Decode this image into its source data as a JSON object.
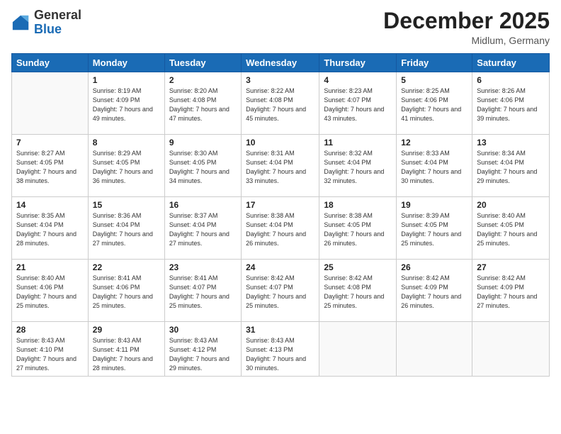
{
  "header": {
    "logo": {
      "general": "General",
      "blue": "Blue"
    },
    "title": "December 2025",
    "location": "Midlum, Germany"
  },
  "calendar": {
    "weekdays": [
      "Sunday",
      "Monday",
      "Tuesday",
      "Wednesday",
      "Thursday",
      "Friday",
      "Saturday"
    ],
    "weeks": [
      [
        {
          "day": "",
          "sunrise": "",
          "sunset": "",
          "daylight": ""
        },
        {
          "day": "1",
          "sunrise": "Sunrise: 8:19 AM",
          "sunset": "Sunset: 4:09 PM",
          "daylight": "Daylight: 7 hours and 49 minutes."
        },
        {
          "day": "2",
          "sunrise": "Sunrise: 8:20 AM",
          "sunset": "Sunset: 4:08 PM",
          "daylight": "Daylight: 7 hours and 47 minutes."
        },
        {
          "day": "3",
          "sunrise": "Sunrise: 8:22 AM",
          "sunset": "Sunset: 4:08 PM",
          "daylight": "Daylight: 7 hours and 45 minutes."
        },
        {
          "day": "4",
          "sunrise": "Sunrise: 8:23 AM",
          "sunset": "Sunset: 4:07 PM",
          "daylight": "Daylight: 7 hours and 43 minutes."
        },
        {
          "day": "5",
          "sunrise": "Sunrise: 8:25 AM",
          "sunset": "Sunset: 4:06 PM",
          "daylight": "Daylight: 7 hours and 41 minutes."
        },
        {
          "day": "6",
          "sunrise": "Sunrise: 8:26 AM",
          "sunset": "Sunset: 4:06 PM",
          "daylight": "Daylight: 7 hours and 39 minutes."
        }
      ],
      [
        {
          "day": "7",
          "sunrise": "Sunrise: 8:27 AM",
          "sunset": "Sunset: 4:05 PM",
          "daylight": "Daylight: 7 hours and 38 minutes."
        },
        {
          "day": "8",
          "sunrise": "Sunrise: 8:29 AM",
          "sunset": "Sunset: 4:05 PM",
          "daylight": "Daylight: 7 hours and 36 minutes."
        },
        {
          "day": "9",
          "sunrise": "Sunrise: 8:30 AM",
          "sunset": "Sunset: 4:05 PM",
          "daylight": "Daylight: 7 hours and 34 minutes."
        },
        {
          "day": "10",
          "sunrise": "Sunrise: 8:31 AM",
          "sunset": "Sunset: 4:04 PM",
          "daylight": "Daylight: 7 hours and 33 minutes."
        },
        {
          "day": "11",
          "sunrise": "Sunrise: 8:32 AM",
          "sunset": "Sunset: 4:04 PM",
          "daylight": "Daylight: 7 hours and 32 minutes."
        },
        {
          "day": "12",
          "sunrise": "Sunrise: 8:33 AM",
          "sunset": "Sunset: 4:04 PM",
          "daylight": "Daylight: 7 hours and 30 minutes."
        },
        {
          "day": "13",
          "sunrise": "Sunrise: 8:34 AM",
          "sunset": "Sunset: 4:04 PM",
          "daylight": "Daylight: 7 hours and 29 minutes."
        }
      ],
      [
        {
          "day": "14",
          "sunrise": "Sunrise: 8:35 AM",
          "sunset": "Sunset: 4:04 PM",
          "daylight": "Daylight: 7 hours and 28 minutes."
        },
        {
          "day": "15",
          "sunrise": "Sunrise: 8:36 AM",
          "sunset": "Sunset: 4:04 PM",
          "daylight": "Daylight: 7 hours and 27 minutes."
        },
        {
          "day": "16",
          "sunrise": "Sunrise: 8:37 AM",
          "sunset": "Sunset: 4:04 PM",
          "daylight": "Daylight: 7 hours and 27 minutes."
        },
        {
          "day": "17",
          "sunrise": "Sunrise: 8:38 AM",
          "sunset": "Sunset: 4:04 PM",
          "daylight": "Daylight: 7 hours and 26 minutes."
        },
        {
          "day": "18",
          "sunrise": "Sunrise: 8:38 AM",
          "sunset": "Sunset: 4:05 PM",
          "daylight": "Daylight: 7 hours and 26 minutes."
        },
        {
          "day": "19",
          "sunrise": "Sunrise: 8:39 AM",
          "sunset": "Sunset: 4:05 PM",
          "daylight": "Daylight: 7 hours and 25 minutes."
        },
        {
          "day": "20",
          "sunrise": "Sunrise: 8:40 AM",
          "sunset": "Sunset: 4:05 PM",
          "daylight": "Daylight: 7 hours and 25 minutes."
        }
      ],
      [
        {
          "day": "21",
          "sunrise": "Sunrise: 8:40 AM",
          "sunset": "Sunset: 4:06 PM",
          "daylight": "Daylight: 7 hours and 25 minutes."
        },
        {
          "day": "22",
          "sunrise": "Sunrise: 8:41 AM",
          "sunset": "Sunset: 4:06 PM",
          "daylight": "Daylight: 7 hours and 25 minutes."
        },
        {
          "day": "23",
          "sunrise": "Sunrise: 8:41 AM",
          "sunset": "Sunset: 4:07 PM",
          "daylight": "Daylight: 7 hours and 25 minutes."
        },
        {
          "day": "24",
          "sunrise": "Sunrise: 8:42 AM",
          "sunset": "Sunset: 4:07 PM",
          "daylight": "Daylight: 7 hours and 25 minutes."
        },
        {
          "day": "25",
          "sunrise": "Sunrise: 8:42 AM",
          "sunset": "Sunset: 4:08 PM",
          "daylight": "Daylight: 7 hours and 25 minutes."
        },
        {
          "day": "26",
          "sunrise": "Sunrise: 8:42 AM",
          "sunset": "Sunset: 4:09 PM",
          "daylight": "Daylight: 7 hours and 26 minutes."
        },
        {
          "day": "27",
          "sunrise": "Sunrise: 8:42 AM",
          "sunset": "Sunset: 4:09 PM",
          "daylight": "Daylight: 7 hours and 27 minutes."
        }
      ],
      [
        {
          "day": "28",
          "sunrise": "Sunrise: 8:43 AM",
          "sunset": "Sunset: 4:10 PM",
          "daylight": "Daylight: 7 hours and 27 minutes."
        },
        {
          "day": "29",
          "sunrise": "Sunrise: 8:43 AM",
          "sunset": "Sunset: 4:11 PM",
          "daylight": "Daylight: 7 hours and 28 minutes."
        },
        {
          "day": "30",
          "sunrise": "Sunrise: 8:43 AM",
          "sunset": "Sunset: 4:12 PM",
          "daylight": "Daylight: 7 hours and 29 minutes."
        },
        {
          "day": "31",
          "sunrise": "Sunrise: 8:43 AM",
          "sunset": "Sunset: 4:13 PM",
          "daylight": "Daylight: 7 hours and 30 minutes."
        },
        {
          "day": "",
          "sunrise": "",
          "sunset": "",
          "daylight": ""
        },
        {
          "day": "",
          "sunrise": "",
          "sunset": "",
          "daylight": ""
        },
        {
          "day": "",
          "sunrise": "",
          "sunset": "",
          "daylight": ""
        }
      ]
    ]
  }
}
